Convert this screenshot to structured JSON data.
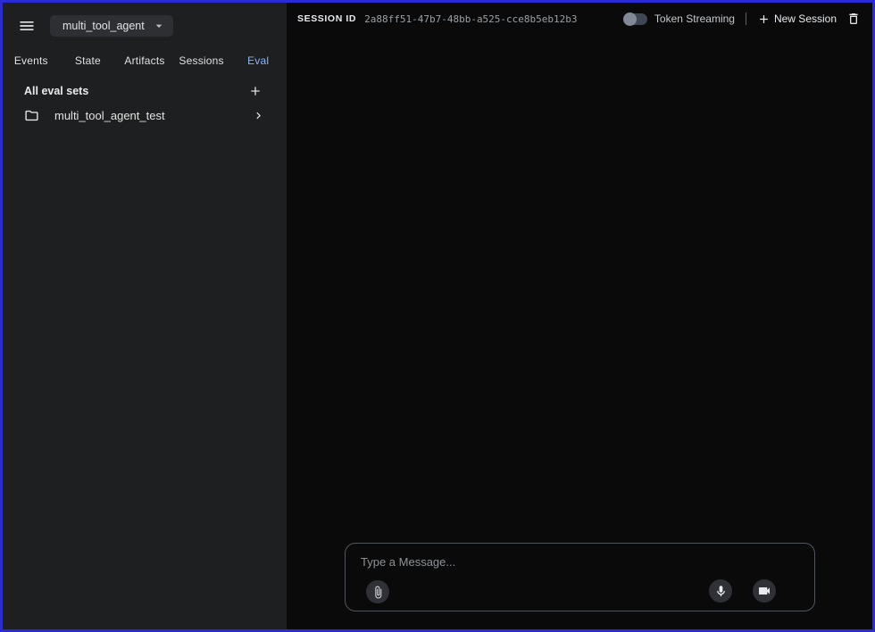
{
  "header": {
    "agent_select": {
      "value": "multi_tool_agent"
    },
    "session": {
      "label": "SESSION ID",
      "value": "2a88ff51-47b7-48bb-a525-cce8b5eb12b3"
    },
    "token_streaming": {
      "label": "Token Streaming",
      "enabled": false
    },
    "new_session": {
      "label": "New Session"
    }
  },
  "sidebar": {
    "tabs": [
      {
        "label": "Events",
        "active": false
      },
      {
        "label": "State",
        "active": false
      },
      {
        "label": "Artifacts",
        "active": false
      },
      {
        "label": "Sessions",
        "active": false
      },
      {
        "label": "Eval",
        "active": true
      }
    ],
    "eval": {
      "section_title": "All eval sets",
      "items": [
        {
          "name": "multi_tool_agent_test"
        }
      ]
    }
  },
  "chat": {
    "input_placeholder": "Type a Message..."
  },
  "icons": {
    "menu": "hamburger",
    "agent_caret": "chevron-down",
    "add_eval_set": "plus",
    "eval_set": "folder",
    "eval_set_open": "chevron-right",
    "delete_session": "trash",
    "attach": "paperclip",
    "voice": "microphone",
    "video": "video-camera",
    "token_streaming": "toggle-off"
  },
  "colors": {
    "accent_blue": "#8ab4f8",
    "frame_border": "#2b2bd5",
    "sidebar_bg": "#1e1f20",
    "main_bg": "#0a0a0b"
  }
}
